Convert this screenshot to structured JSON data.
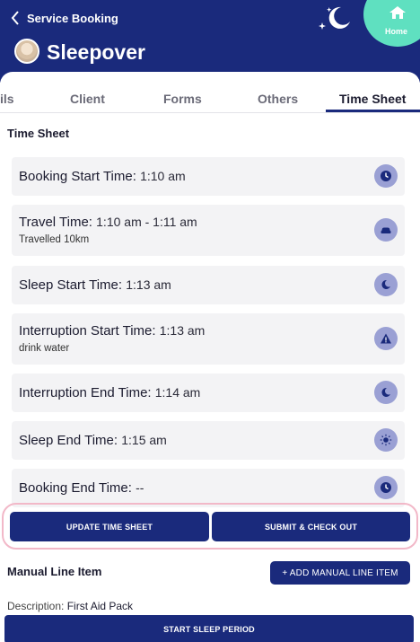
{
  "header": {
    "back_label": "Service Booking",
    "title": "Sleepover",
    "home_label": "Home"
  },
  "tabs": [
    {
      "label": "ils"
    },
    {
      "label": "Client"
    },
    {
      "label": "Forms"
    },
    {
      "label": "Others"
    },
    {
      "label": "Time Sheet"
    }
  ],
  "time_sheet": {
    "section_title": "Time Sheet",
    "rows": [
      {
        "label": "Booking Start Time:",
        "value": "1:10 am",
        "sub": "",
        "icon": "clock-icon"
      },
      {
        "label": "Travel Time:",
        "value": "1:10 am - 1:11 am",
        "sub": "Travelled 10km",
        "icon": "car-icon"
      },
      {
        "label": "Sleep Start Time:",
        "value": "1:13 am",
        "sub": "",
        "icon": "moon-icon"
      },
      {
        "label": "Interruption Start Time:",
        "value": "1:13 am",
        "sub": "drink water",
        "icon": "warning-icon"
      },
      {
        "label": "Interruption End Time:",
        "value": "1:14 am",
        "sub": "",
        "icon": "moon-icon"
      },
      {
        "label": "Sleep End Time:",
        "value": "1:15 am",
        "sub": "",
        "icon": "sun-icon"
      },
      {
        "label": "Booking End Time:",
        "value": "--",
        "sub": "",
        "icon": "clock-icon"
      }
    ]
  },
  "actions": {
    "update_label": "UPDATE TIME SHEET",
    "submit_label": "SUBMIT & CHECK OUT"
  },
  "manual_line_item": {
    "title": "Manual Line Item",
    "add_label": "+ ADD MANUAL LINE ITEM",
    "description_label": "Description:",
    "description_value": "First Aid Pack"
  },
  "footer": {
    "start_sleep_label": "START SLEEP PERIOD"
  },
  "colors": {
    "primary": "#1a2a7c",
    "accent": "#5fe0c0",
    "icon_bg": "#9aa0d4",
    "highlight": "#f2b8c8"
  }
}
